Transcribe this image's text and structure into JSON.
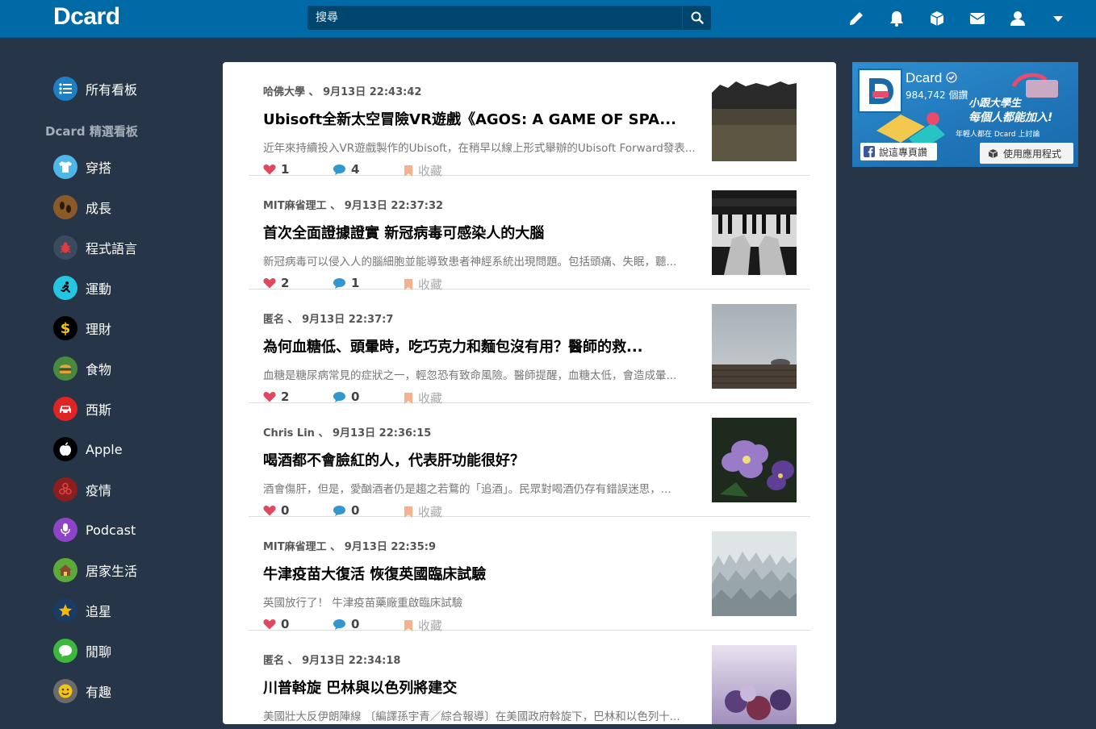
{
  "header": {
    "logo": "Dcard",
    "search_placeholder": "搜尋",
    "icons": [
      "pencil-icon",
      "bell-icon",
      "cube-icon",
      "mail-icon",
      "user-icon",
      "caret-down-icon"
    ],
    "bg_color": "#006AA6"
  },
  "sidebar": {
    "all_boards": "所有看板",
    "featured_heading": "Dcard 精選看板",
    "items": [
      {
        "label": "穿搭",
        "icon": "tshirt-icon",
        "color": "#4FB6E8"
      },
      {
        "label": "成長",
        "icon": "footprints-icon",
        "color": "#8B5A2B"
      },
      {
        "label": "程式語言",
        "icon": "bug-icon",
        "color": "#3B4A5E"
      },
      {
        "label": "運動",
        "icon": "runner-icon",
        "color": "#24C6E0"
      },
      {
        "label": "理財",
        "icon": "dollar-icon",
        "color": "#000000"
      },
      {
        "label": "食物",
        "icon": "burger-icon",
        "color": "#4A8A3E"
      },
      {
        "label": "西斯",
        "icon": "car-icon",
        "color": "#E02424"
      },
      {
        "label": "Apple",
        "icon": "apple-icon",
        "color": "#000000"
      },
      {
        "label": "疫情",
        "icon": "biohazard-icon",
        "color": "#8B1E1E"
      },
      {
        "label": "Podcast",
        "icon": "microphone-icon",
        "color": "#8E44C9"
      },
      {
        "label": "居家生活",
        "icon": "house-icon",
        "color": "#5BAA3A"
      },
      {
        "label": "追星",
        "icon": "star-icon",
        "color": "#F5B90A"
      },
      {
        "label": "閒聊",
        "icon": "chat-icon",
        "color": "#3CB83C"
      },
      {
        "label": "有趣",
        "icon": "smiley-icon",
        "color": "#F0C419"
      }
    ]
  },
  "posts": [
    {
      "author": "哈佛大學",
      "sep": "、",
      "time": "9月13日 22:43:42",
      "title": "Ubisoft全新太空冒險VR遊戲《AGOS: A GAME OF SPA...",
      "excerpt": "近年來持續投入VR遊戲製作的Ubisoft，在稍早以線上形式舉辦的Ubisoft Forward發表...",
      "likes": "1",
      "comments": "4",
      "save": "收藏",
      "thumb": "forest-landscape"
    },
    {
      "author": "MIT麻省理工",
      "sep": "、",
      "time": "9月13日 22:37:32",
      "title": "首次全面證據證實 新冠病毒可感染人的大腦",
      "excerpt": "新冠病毒可以侵入人的腦細胞並能導致患者神經系統出現問題。包括頭痛、失眠，聽...",
      "likes": "2",
      "comments": "1",
      "save": "收藏",
      "thumb": "piano-hands"
    },
    {
      "author": "匿名",
      "sep": "、",
      "time": "9月13日 22:37:7",
      "title": "為何血糖低、頭暈時，吃巧克力和麵包沒有用？醫師的救...",
      "excerpt": "血糖是糖尿病常見的症狀之一，輕忽恐有致命風險。醫師提醒，血糖太低，會造成暈...",
      "likes": "2",
      "comments": "0",
      "save": "收藏",
      "thumb": "foggy-pier"
    },
    {
      "author": "Chris Lin",
      "sep": "、",
      "time": "9月13日 22:36:15",
      "title": "喝酒都不會臉紅的人，代表肝功能很好？",
      "excerpt": "酒會傷肝，但是，愛酗酒者仍是趨之若鶩的「追酒」。民眾對喝酒仍存有錯誤迷思，...",
      "likes": "0",
      "comments": "0",
      "save": "收藏",
      "thumb": "purple-flowers"
    },
    {
      "author": "MIT麻省理工",
      "sep": "、",
      "time": "9月13日 22:35:9",
      "title": "牛津疫苗大復活 恢復英國臨床試驗",
      "excerpt": "英國放行了！ 牛津疫苗藥廠重啟臨床試驗",
      "likes": "0",
      "comments": "0",
      "save": "收藏",
      "thumb": "snowy-forest"
    },
    {
      "author": "匿名",
      "sep": "、",
      "time": "9月13日 22:34:18",
      "title": "川普斡旋 巴林與以色列將建交",
      "excerpt": "美國壯大反伊朗陣線 〔編譯孫宇青／綜合報導〕在美國政府斡旋下，巴林和以色列十...",
      "likes": "",
      "comments": "",
      "save": "",
      "thumb": "frozen-berries"
    }
  ],
  "ad": {
    "name": "Dcard",
    "likes": "984,742 個讚",
    "slogan1": "小跟大學生",
    "slogan2": "每個人都能加入!",
    "slogan3": "年輕人都在 Dcard 上討論",
    "like_button": "說這專頁讚",
    "app_button": "使用應用程式"
  }
}
